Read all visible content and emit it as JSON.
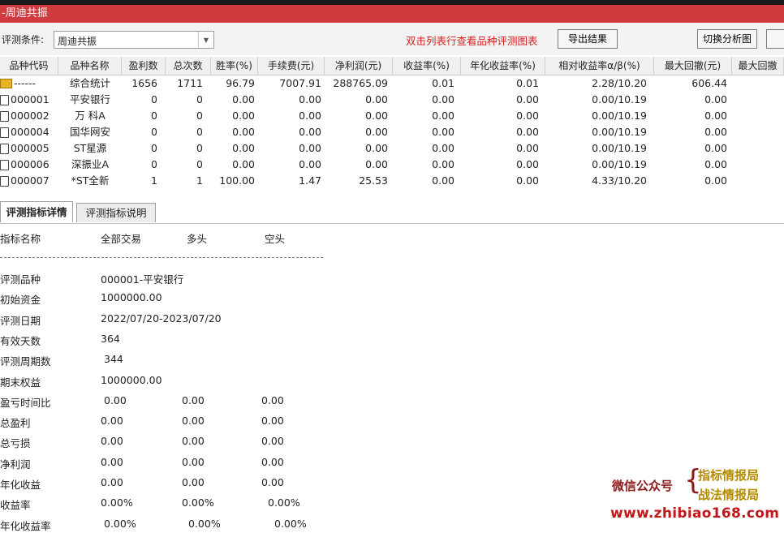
{
  "window": {
    "title": "-周迪共振"
  },
  "toolbar": {
    "condition_label": "评测条件:",
    "condition_value": "周迪共振",
    "hint": "双击列表行查看品种评测图表",
    "export_label": "导出结果",
    "switch_label": "切换分析图"
  },
  "grid": {
    "columns": [
      "品种代码",
      "品种名称",
      "盈利数",
      "总次数",
      "胜率(%)",
      "手续费(元)",
      "净利润(元)",
      "收益率(%)",
      "年化收益率(%)",
      "相对收益率α/β(%)",
      "最大回撤(元)",
      "最大回撤"
    ],
    "rows": [
      {
        "code": "------",
        "name": "综合统计",
        "profit": "1656",
        "total": "1711",
        "win": "96.79",
        "fee": "7007.91",
        "net": "288765.09",
        "ret": "0.01",
        "annual": "0.01",
        "relative": "2.28/10.20",
        "drawdown": "606.44",
        "icon": "folder"
      },
      {
        "code": "000001",
        "name": "平安银行",
        "profit": "0",
        "total": "0",
        "win": "0.00",
        "fee": "0.00",
        "net": "0.00",
        "ret": "0.00",
        "annual": "0.00",
        "relative": "0.00/10.19",
        "drawdown": "0.00",
        "icon": "doc"
      },
      {
        "code": "000002",
        "name": "万 科A",
        "profit": "0",
        "total": "0",
        "win": "0.00",
        "fee": "0.00",
        "net": "0.00",
        "ret": "0.00",
        "annual": "0.00",
        "relative": "0.00/10.19",
        "drawdown": "0.00",
        "icon": "doc"
      },
      {
        "code": "000004",
        "name": "国华网安",
        "profit": "0",
        "total": "0",
        "win": "0.00",
        "fee": "0.00",
        "net": "0.00",
        "ret": "0.00",
        "annual": "0.00",
        "relative": "0.00/10.19",
        "drawdown": "0.00",
        "icon": "doc"
      },
      {
        "code": "000005",
        "name": "ST星源",
        "profit": "0",
        "total": "0",
        "win": "0.00",
        "fee": "0.00",
        "net": "0.00",
        "ret": "0.00",
        "annual": "0.00",
        "relative": "0.00/10.19",
        "drawdown": "0.00",
        "icon": "doc"
      },
      {
        "code": "000006",
        "name": "深振业A",
        "profit": "0",
        "total": "0",
        "win": "0.00",
        "fee": "0.00",
        "net": "0.00",
        "ret": "0.00",
        "annual": "0.00",
        "relative": "0.00/10.19",
        "drawdown": "0.00",
        "icon": "doc"
      },
      {
        "code": "000007",
        "name": "*ST全新",
        "profit": "1",
        "total": "1",
        "win": "100.00",
        "fee": "1.47",
        "net": "25.53",
        "ret": "0.00",
        "annual": "0.00",
        "relative": "4.33/10.20",
        "drawdown": "0.00",
        "icon": "doc"
      }
    ]
  },
  "tabs": [
    {
      "label": "评测指标详情",
      "active": true
    },
    {
      "label": "评测指标说明",
      "active": false
    }
  ],
  "detail": {
    "headers": [
      "指标名称",
      "全部交易",
      "多头",
      "空头"
    ],
    "rows": [
      {
        "label": "评测品种",
        "all": "000001-平安银行",
        "long": "",
        "short": ""
      },
      {
        "label": "初始资金",
        "all": "1000000.00",
        "long": "",
        "short": ""
      },
      {
        "label": "评测日期",
        "all": "2022/07/20-2023/07/20",
        "long": "",
        "short": ""
      },
      {
        "label": "有效天数",
        "all": "364",
        "long": "",
        "short": ""
      },
      {
        "label": "评测周期数",
        "all": "344",
        "long": "",
        "short": ""
      },
      {
        "label": "期末权益",
        "all": "1000000.00",
        "long": "",
        "short": ""
      },
      {
        "label": "盈亏时间比",
        "all": "0.00",
        "long": "0.00",
        "short": "0.00"
      },
      {
        "label": "总盈利",
        "all": "0.00",
        "long": "0.00",
        "short": "0.00"
      },
      {
        "label": "总亏损",
        "all": "0.00",
        "long": "0.00",
        "short": "0.00"
      },
      {
        "label": "净利润",
        "all": "0.00",
        "long": "0.00",
        "short": "0.00"
      },
      {
        "label": "年化收益",
        "all": "0.00",
        "long": "0.00",
        "short": "0.00"
      },
      {
        "label": "收益率",
        "all": "0.00%",
        "long": "0.00%",
        "short": "0.00%"
      },
      {
        "label": "年化收益率",
        "all": "0.00%",
        "long": "0.00%",
        "short": "0.00%"
      }
    ]
  },
  "watermark": {
    "wechat": "微信公众号",
    "brace": "{",
    "line1": "指标情报局",
    "line2": "战法情报局",
    "url": "www.zhibiao168.com"
  }
}
